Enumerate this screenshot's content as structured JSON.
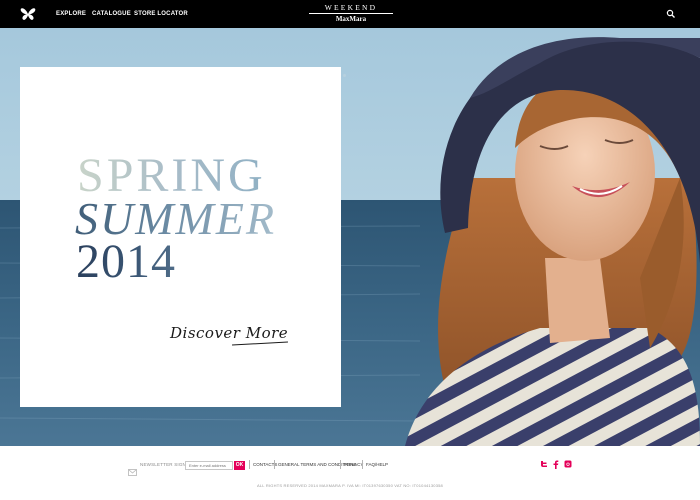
{
  "header": {
    "logo_icon": "butterfly-icon",
    "nav": [
      "EXPLORE",
      "CATALOGUE",
      "STORE LOCATOR"
    ],
    "brand_top": "WEEKEND",
    "brand_bottom": "MaxMara",
    "search_icon": "search-icon"
  },
  "hero": {
    "slides_total": 2,
    "active_slide": 1,
    "card": {
      "line1": "SPRING",
      "line2": "SUMMER",
      "line3": "2014",
      "cta": "Discover More"
    }
  },
  "footer": {
    "newsletter_label": "NEWSLETTER SIGN UP",
    "email_placeholder": "Enter e-mail address",
    "ok_label": "OK",
    "links": [
      "CONTACTS",
      "GENERAL TERMS AND CONDITIONS",
      "PRIVACY",
      "FAQ/HELP"
    ],
    "social_icons": [
      "twitter-icon",
      "facebook-icon",
      "instagram-icon"
    ],
    "copyright": "ALL RIGHTS RESERVED 2014 MAXMARA P. IVA MI: IT01397630350     VAT NO: IT01044130358"
  },
  "colors": {
    "nav_bg": "#000000",
    "accent": "#e40059",
    "sea": "#2f5a78",
    "sky": "#a9cadd"
  }
}
